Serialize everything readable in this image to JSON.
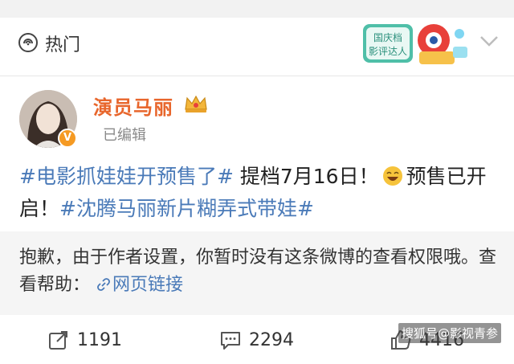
{
  "header": {
    "hot_label": "热门",
    "badge_line1": "国庆档",
    "badge_line2": "影评达人"
  },
  "post": {
    "author": "演员马丽",
    "edited": "已编辑",
    "tag1": "#电影抓娃娃开预售了#",
    "text1": " 提档7月16日！",
    "text2": "预售已开启！",
    "tag2": "#沈腾马丽新片糊弄式带娃#"
  },
  "notice": {
    "text": "抱歉，由于作者设置，你暂时没有这条微博的查看权限哦。查看帮助：",
    "link_label": "网页链接"
  },
  "actions": {
    "reposts": "1191",
    "comments": "2294",
    "likes": "4416"
  },
  "watermark": "搜狐号@影视青参",
  "colors": {
    "author": "#e8662c",
    "link": "#4a7ab8",
    "background": "#f2f2f2"
  }
}
